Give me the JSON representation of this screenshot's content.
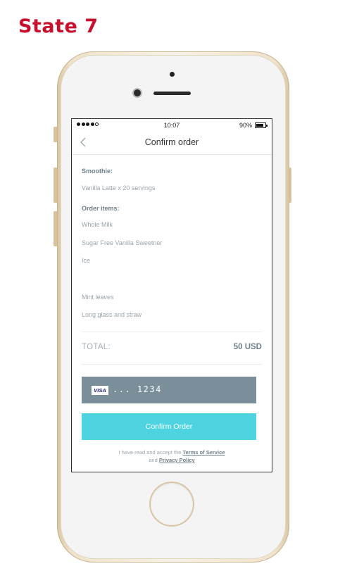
{
  "page": {
    "heading": "State 7",
    "heading_color": "#c8102e"
  },
  "status_bar": {
    "time": "10:07",
    "battery": "90%"
  },
  "nav": {
    "title": "Confirm order"
  },
  "order": {
    "smoothie_label": "Smoothie:",
    "smoothie_value": "Vanilla Latte x 20 servings",
    "items_label": "Order items:",
    "items": [
      "Whole Milk",
      "Sugar Free Vanilla Sweetner",
      "Ice",
      "Mint leaves",
      "Long glass and straw"
    ]
  },
  "total": {
    "label": "TOTAL:",
    "value": "50 USD"
  },
  "payment": {
    "brand": "VISA",
    "masked_number": "... 1234",
    "background": "#7a8f99"
  },
  "confirm_button": {
    "label": "Confirm Order",
    "color": "#4ed3e0"
  },
  "legal": {
    "text_before": "I have read and accept the",
    "terms_link": "Terms of Service",
    "text_and": "and",
    "privacy_link": "Privacy Policy"
  }
}
